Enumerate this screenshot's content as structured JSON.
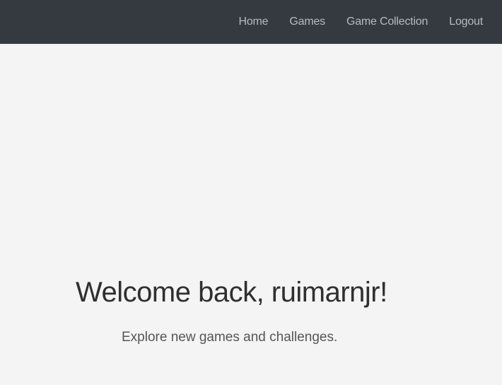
{
  "nav": {
    "items": [
      {
        "label": "Home"
      },
      {
        "label": "Games"
      },
      {
        "label": "Game Collection"
      },
      {
        "label": "Logout"
      }
    ]
  },
  "hero": {
    "title": "Welcome back, ruimarnjr!",
    "subtitle": "Explore new games and challenges."
  },
  "colors": {
    "navbar_bg": "#343a40",
    "nav_link": "#b8bbbf",
    "page_bg": "#f4f4f4",
    "title_text": "#2f2f2f",
    "subtitle_text": "#555555"
  }
}
